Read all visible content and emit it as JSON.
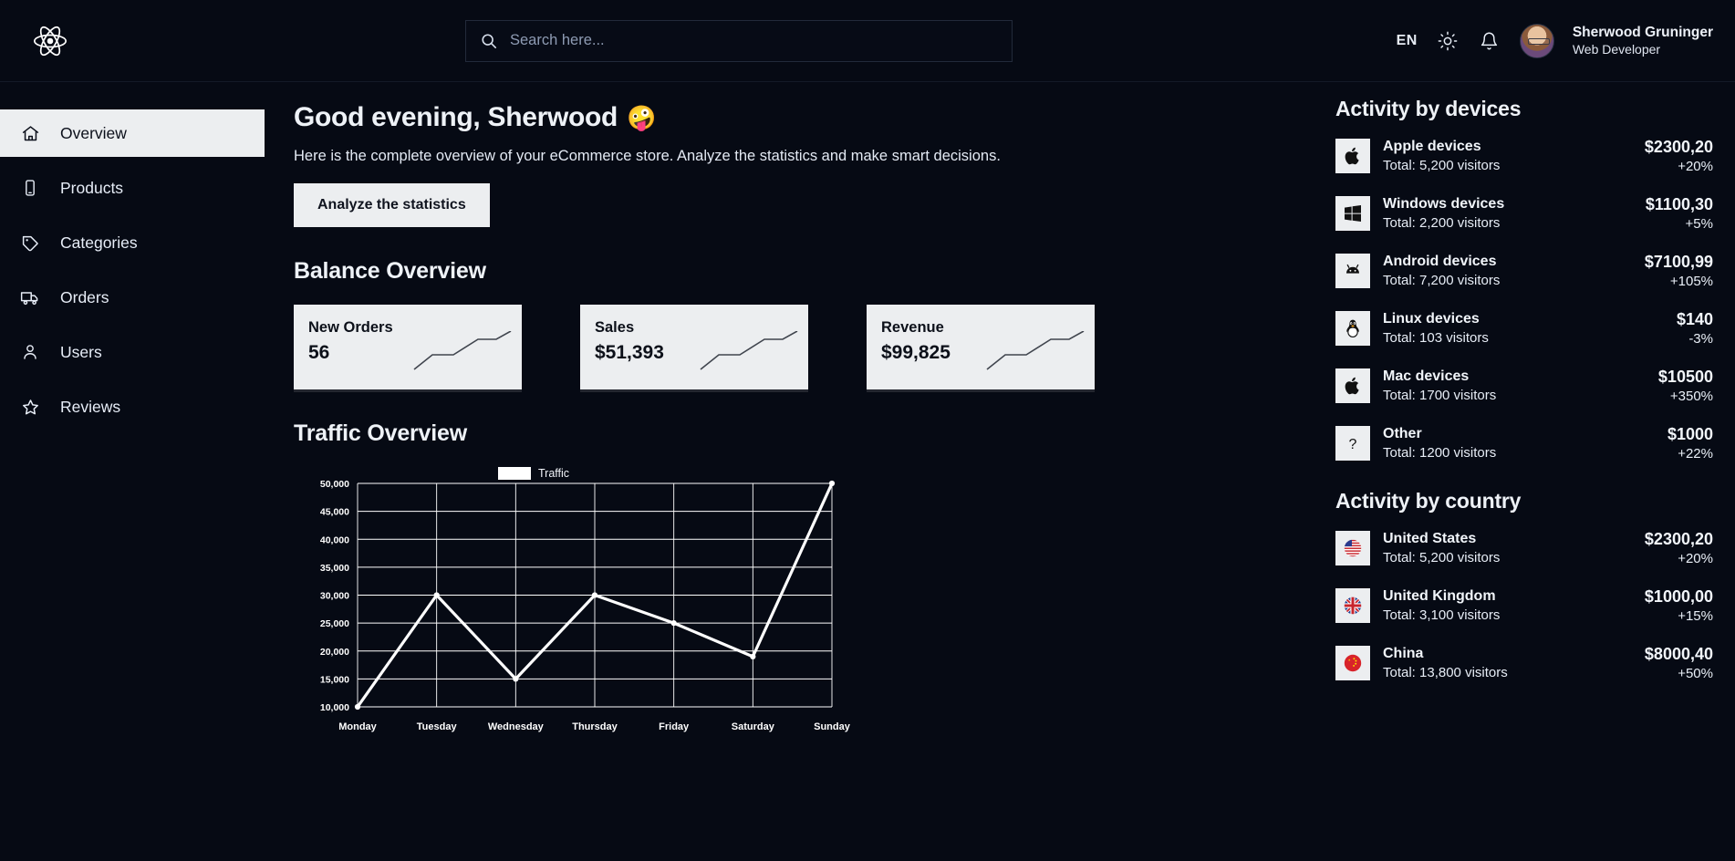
{
  "header": {
    "logo_icon": "react-logo-icon",
    "search": {
      "placeholder": "Search here...",
      "value": "",
      "icon": "search-icon"
    },
    "language": "EN",
    "theme_icon": "sun-icon",
    "notifications_icon": "bell-icon",
    "user": {
      "name": "Sherwood Gruninger",
      "role": "Web Developer",
      "avatar": "user-avatar"
    }
  },
  "sidebar": {
    "items": [
      {
        "label": "Overview",
        "icon": "home-icon",
        "active": true
      },
      {
        "label": "Products",
        "icon": "phone-icon",
        "active": false
      },
      {
        "label": "Categories",
        "icon": "tag-icon",
        "active": false
      },
      {
        "label": "Orders",
        "icon": "truck-icon",
        "active": false
      },
      {
        "label": "Users",
        "icon": "user-icon",
        "active": false
      },
      {
        "label": "Reviews",
        "icon": "star-icon",
        "active": false
      }
    ]
  },
  "main": {
    "greeting": "Good evening, Sherwood",
    "greeting_emoji": "🤪",
    "subtitle": "Here is the complete overview of your eCommerce store. Analyze the statistics and make smart decisions.",
    "cta_label": "Analyze the statistics",
    "balance_title": "Balance Overview",
    "balance_cards": [
      {
        "label": "New Orders",
        "value": "56"
      },
      {
        "label": "Sales",
        "value": "$51,393"
      },
      {
        "label": "Revenue",
        "value": "$99,825"
      }
    ],
    "traffic_title": "Traffic Overview"
  },
  "chart_data": {
    "type": "line",
    "title": "Traffic Overview",
    "xlabel": "",
    "ylabel": "",
    "categories": [
      "Monday",
      "Tuesday",
      "Wednesday",
      "Thursday",
      "Friday",
      "Saturday",
      "Sunday"
    ],
    "series": [
      {
        "name": "Traffic",
        "values": [
          10000,
          30000,
          15000,
          30000,
          25000,
          19000,
          50000
        ],
        "color": "#ffffff"
      }
    ],
    "ylim": [
      10000,
      50000
    ],
    "yticks": [
      "10,000",
      "15,000",
      "20,000",
      "25,000",
      "30,000",
      "35,000",
      "40,000",
      "45,000",
      "50,000"
    ],
    "grid": true,
    "legend_position": "top-center",
    "legend_entries": [
      "Traffic"
    ]
  },
  "devices_panel": {
    "title": "Activity by devices",
    "rows": [
      {
        "icon": "apple-icon",
        "name": "Apple devices",
        "sub": "Total: 5,200 visitors",
        "amount": "$2300,20",
        "delta": "+20%"
      },
      {
        "icon": "windows-icon",
        "name": "Windows devices",
        "sub": "Total: 2,200 visitors",
        "amount": "$1100,30",
        "delta": "+5%"
      },
      {
        "icon": "android-icon",
        "name": "Android devices",
        "sub": "Total: 7,200 visitors",
        "amount": "$7100,99",
        "delta": "+105%"
      },
      {
        "icon": "linux-icon",
        "name": "Linux devices",
        "sub": "Total: 103 visitors",
        "amount": "$140",
        "delta": "-3%"
      },
      {
        "icon": "apple-icon",
        "name": "Mac devices",
        "sub": "Total: 1700 visitors",
        "amount": "$10500",
        "delta": "+350%"
      },
      {
        "icon": "question-icon",
        "name": "Other",
        "sub": "Total: 1200 visitors",
        "amount": "$1000",
        "delta": "+22%"
      }
    ]
  },
  "country_panel": {
    "title": "Activity by country",
    "rows": [
      {
        "icon": "flag-us-icon",
        "name": "United States",
        "sub": "Total: 5,200 visitors",
        "amount": "$2300,20",
        "delta": "+20%"
      },
      {
        "icon": "flag-uk-icon",
        "name": "United Kingdom",
        "sub": "Total: 3,100 visitors",
        "amount": "$1000,00",
        "delta": "+15%"
      },
      {
        "icon": "flag-cn-icon",
        "name": "China",
        "sub": "Total: 13,800 visitors",
        "amount": "$8000,40",
        "delta": "+50%"
      }
    ]
  },
  "colors": {
    "background": "#060a14",
    "surface": "#eceef0",
    "text": "#eef2f7",
    "accent": "#ffffff"
  }
}
